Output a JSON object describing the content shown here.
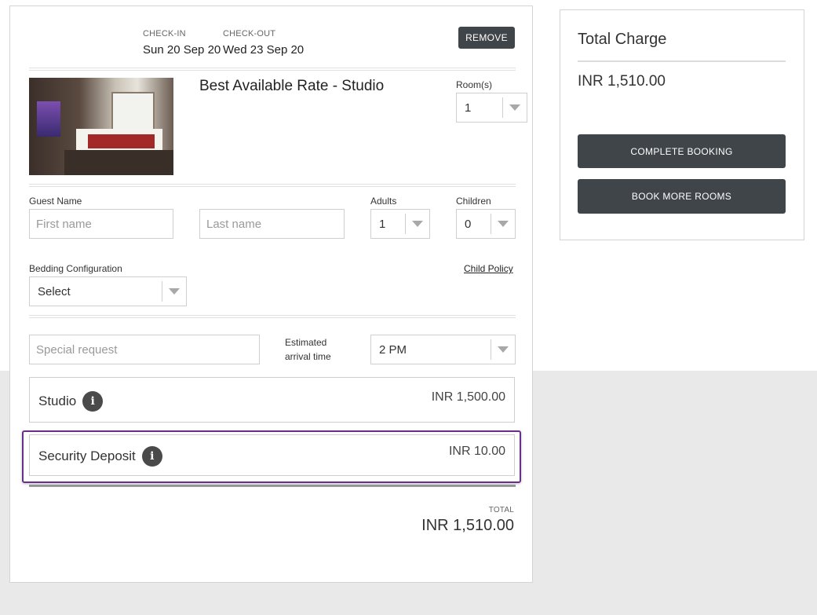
{
  "booking": {
    "checkin_label": "CHECK-IN",
    "checkin_date": "Sun 20 Sep 20",
    "checkout_label": "CHECK-OUT",
    "checkout_date": "Wed 23 Sep 20",
    "remove_label": "REMOVE"
  },
  "room": {
    "title": "Best Available Rate - Studio",
    "rooms_label": "Room(s)",
    "rooms_value": "1"
  },
  "guest": {
    "guest_name_label": "Guest Name",
    "first_name_placeholder": "First name",
    "last_name_placeholder": "Last name",
    "adults_label": "Adults",
    "adults_value": "1",
    "children_label": "Children",
    "children_value": "0",
    "bedding_label": "Bedding Configuration",
    "bedding_value": "Select",
    "child_policy_label": "Child Policy",
    "special_request_placeholder": "Special request",
    "arrival_label_line1": "Estimated",
    "arrival_label_line2": "arrival time",
    "arrival_value": "2 PM"
  },
  "charges": {
    "lines": [
      {
        "name": "Studio",
        "price": "INR 1,500.00"
      },
      {
        "name": "Security Deposit",
        "price": "INR 10.00"
      }
    ],
    "total_label": "TOTAL",
    "total_value": "INR 1,510.00"
  },
  "summary": {
    "title": "Total Charge",
    "amount": "INR 1,510.00",
    "complete_label": "COMPLETE BOOKING",
    "more_rooms_label": "BOOK MORE ROOMS"
  },
  "colors": {
    "highlight": "#6a2f8a",
    "button_dark": "#3f4549"
  }
}
